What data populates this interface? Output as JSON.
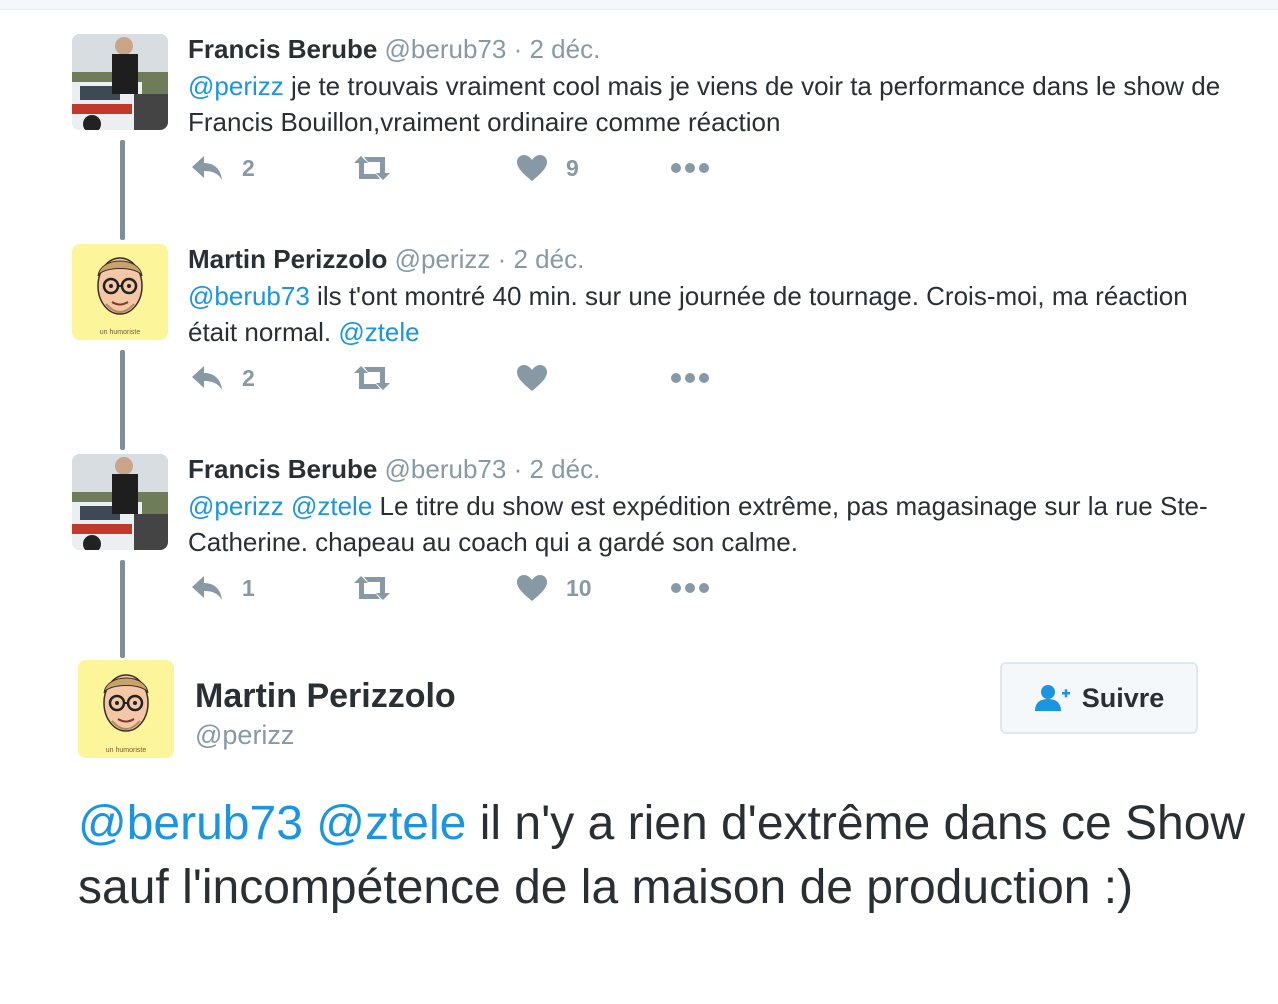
{
  "tweets": [
    {
      "name": "Francis Berube",
      "handle": "@berub73",
      "dot": "·",
      "date": "2 déc.",
      "mentions": [
        "@perizz"
      ],
      "text": "je te trouvais vraiment cool mais je viens de voir ta performance dans le show de Francis Bouillon,vraiment ordinaire comme réaction",
      "replies": "2",
      "likes": "9",
      "avatar": "car-photo-avatar"
    },
    {
      "name": "Martin Perizzolo",
      "handle": "@perizz",
      "dot": "·",
      "date": "2 déc.",
      "mentions": [
        "@berub73"
      ],
      "text": "ils t'ont montré 40 min. sur une journée de tournage. Crois-moi, ma réaction était normal.",
      "trailing_mention": "@ztele",
      "replies": "2",
      "likes": "",
      "avatar": "cartoon-face-avatar",
      "avatar_caption": "un humoriste"
    },
    {
      "name": "Francis Berube",
      "handle": "@berub73",
      "dot": "·",
      "date": "2 déc.",
      "mentions": [
        "@perizz",
        "@ztele"
      ],
      "text": "Le titre du show est expédition extrême, pas magasinage sur la rue Ste-Catherine. chapeau au coach qui a gardé son calme.",
      "replies": "1",
      "likes": "10",
      "avatar": "car-photo-avatar"
    }
  ],
  "main_tweet": {
    "name": "Martin Perizzolo",
    "handle": "@perizz",
    "follow_label": "Suivre",
    "mentions": [
      "@berub73",
      "@ztele"
    ],
    "text": "il n'y a rien d'extrême dans ce Show sauf l'incompétence de la maison de production :)",
    "avatar_caption": "un humoriste"
  },
  "colors": {
    "mention": "#1b95e0",
    "muted": "#8899a6",
    "text": "#292f33",
    "thread_line": "#7f8e98",
    "avatar_yellow": "#fdf59a"
  }
}
